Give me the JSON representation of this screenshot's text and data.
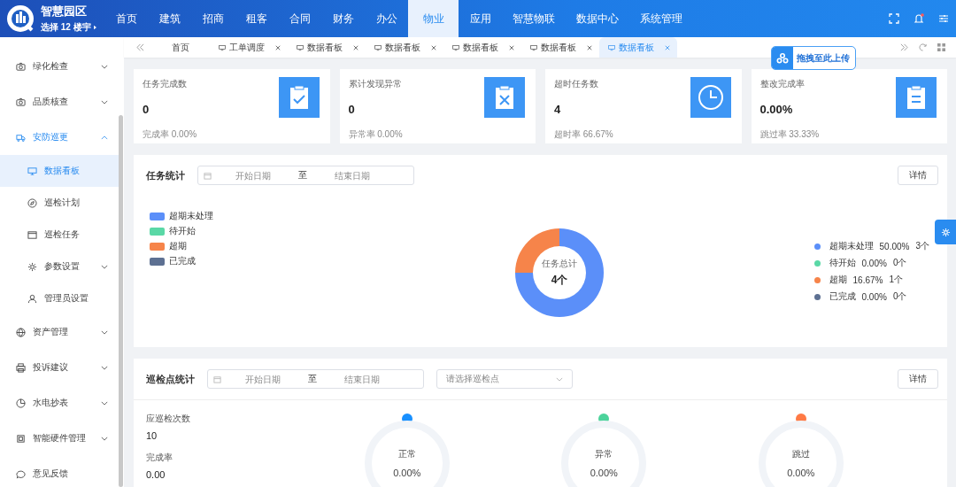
{
  "brand": {
    "title": "智慧园区",
    "subtitle": "选择 12 楼宇"
  },
  "nav": [
    {
      "label": "首页",
      "selected": false
    },
    {
      "label": "建筑",
      "selected": false
    },
    {
      "label": "招商",
      "selected": false
    },
    {
      "label": "租客",
      "selected": false
    },
    {
      "label": "合同",
      "selected": false
    },
    {
      "label": "财务",
      "selected": false
    },
    {
      "label": "办公",
      "selected": false
    },
    {
      "label": "物业",
      "selected": true
    },
    {
      "label": "应用",
      "selected": false
    },
    {
      "label": "智慧物联",
      "selected": false
    },
    {
      "label": "数据中心",
      "selected": false
    },
    {
      "label": "系统管理",
      "selected": false
    }
  ],
  "notifications": {
    "unread": true
  },
  "tabs": [
    {
      "label": "首页",
      "closable": false,
      "selected": false
    },
    {
      "label": "工单调度",
      "closable": true,
      "selected": false
    },
    {
      "label": "数据看板",
      "closable": true,
      "selected": false
    },
    {
      "label": "数据看板",
      "closable": true,
      "selected": false
    },
    {
      "label": "数据看板",
      "closable": true,
      "selected": false
    },
    {
      "label": "数据看板",
      "closable": true,
      "selected": false
    },
    {
      "label": "数据看板",
      "closable": true,
      "selected": true
    }
  ],
  "upload_badge": "拖拽至此上传",
  "sidebar": {
    "items": [
      {
        "label": "绿化检查",
        "expanded": false,
        "selected": false
      },
      {
        "label": "品质核查",
        "expanded": false,
        "selected": false
      },
      {
        "label": "安防巡更",
        "expanded": true,
        "selected": true,
        "children": [
          {
            "label": "数据看板",
            "selected": true
          },
          {
            "label": "巡检计划",
            "selected": false
          },
          {
            "label": "巡检任务",
            "selected": false
          },
          {
            "label": "参数设置",
            "expanded": false,
            "selected": false
          },
          {
            "label": "管理员设置",
            "selected": false
          }
        ]
      },
      {
        "label": "资产管理",
        "expanded": false,
        "selected": false
      },
      {
        "label": "投诉建议",
        "expanded": false,
        "selected": false
      },
      {
        "label": "水电抄表",
        "expanded": false,
        "selected": false
      },
      {
        "label": "智能硬件管理",
        "expanded": false,
        "selected": false
      },
      {
        "label": "意见反馈",
        "selected": false
      }
    ]
  },
  "stats": [
    {
      "title": "任务完成数",
      "value": "0",
      "sub": "完成率 0.00%"
    },
    {
      "title": "累计发现异常",
      "value": "0",
      "sub": "异常率 0.00%"
    },
    {
      "title": "超时任务数",
      "value": "4",
      "sub": "超时率 66.67%"
    },
    {
      "title": "整改完成率",
      "value": "0.00%",
      "sub": "跳过率 33.33%"
    }
  ],
  "task_stats": {
    "title": "任务统计",
    "start_placeholder": "开始日期",
    "separator": "至",
    "end_placeholder": "结束日期",
    "detail_button": "详情",
    "center_label": "任务总计",
    "center_value": "4个",
    "left_legend": [
      {
        "color": "#5b8ff9"
      },
      {
        "color": "#5ad8a6"
      },
      {
        "color": "#f6844a"
      },
      {
        "color": "#5d7092"
      }
    ],
    "legend": [
      {
        "name": "超期未处理",
        "percent": "50.00%",
        "count": "3个",
        "color": "#5b8ff9"
      },
      {
        "name": "待开始",
        "percent": "0.00%",
        "count": "0个",
        "color": "#5ad8a6"
      },
      {
        "name": "超期",
        "percent": "16.67%",
        "count": "1个",
        "color": "#f6844a"
      },
      {
        "name": "已完成",
        "percent": "0.00%",
        "count": "0个",
        "color": "#5d7092"
      }
    ],
    "chart_data": {
      "type": "donut",
      "categories": [
        "超期未处理",
        "待开始",
        "超期",
        "已完成"
      ],
      "values": [
        75,
        0,
        25,
        0
      ]
    }
  },
  "patrol_stats": {
    "title": "巡检点统计",
    "start_placeholder": "开始日期",
    "separator": "至",
    "end_placeholder": "结束日期",
    "point_placeholder": "请选择巡检点",
    "detail_button": "详情",
    "figures": [
      {
        "label": "应巡检次数",
        "value": "10"
      },
      {
        "label": "完成率",
        "value": "0.00"
      }
    ],
    "rings": [
      {
        "label": "正常",
        "value": "0.00%",
        "color": "#1890ff"
      },
      {
        "label": "异常",
        "value": "0.00%",
        "color": "#4cd39b"
      },
      {
        "label": "跳过",
        "value": "0.00%",
        "color": "#ff7a45"
      }
    ]
  }
}
